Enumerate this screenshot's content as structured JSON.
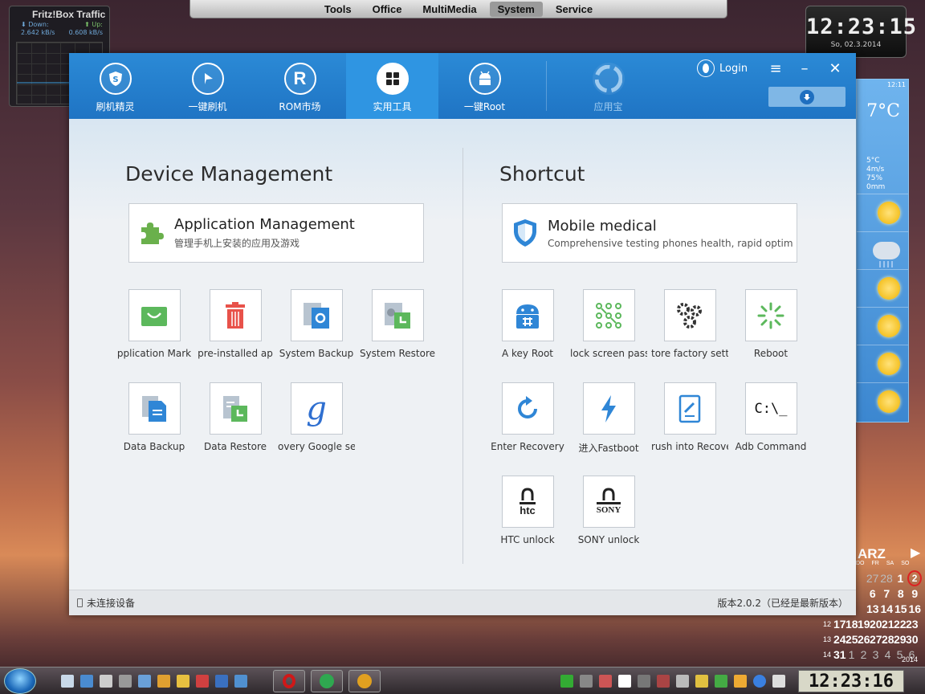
{
  "desktop_menu": {
    "items": [
      "Tools",
      "Office",
      "MultiMedia",
      "System",
      "Service"
    ],
    "active_index": 3
  },
  "fritzbox": {
    "title": "Fritz!Box Traffic",
    "down_label": "Down:",
    "down_value": "2.642 kB/s",
    "up_label": "Up:",
    "up_value": "0.608 kB/s"
  },
  "clock_gadget": {
    "time": "12:23:15",
    "date": "So, 02.3.2014"
  },
  "weather": {
    "small_time": "12:11",
    "temp": "7°C",
    "details": [
      "5°C",
      "4m/s",
      "75%",
      "0mm"
    ],
    "forecast_icons": [
      "sun-icon",
      "rain-cloud-icon",
      "sun-icon",
      "sun-icon",
      "sun-icon",
      "sun-icon"
    ]
  },
  "calendar": {
    "month": "ARZ",
    "weekday_headers": [
      "DO",
      "FR",
      "SA",
      "SO"
    ],
    "weeks": [
      {
        "kw": "",
        "days": [
          "27",
          "28",
          "1",
          "2"
        ]
      },
      {
        "kw": "",
        "days": [
          "6",
          "7",
          "8",
          "9"
        ]
      },
      {
        "kw": "",
        "days": [
          "13",
          "14",
          "15",
          "16"
        ]
      },
      {
        "kw": "12",
        "days": [
          "17",
          "18",
          "19",
          "20",
          "21",
          "22",
          "23"
        ]
      },
      {
        "kw": "13",
        "days": [
          "24",
          "25",
          "26",
          "27",
          "28",
          "29",
          "30"
        ]
      },
      {
        "kw": "14",
        "days": [
          "31",
          "1",
          "2",
          "3",
          "4",
          "5",
          "6"
        ]
      }
    ],
    "year": "2014"
  },
  "app": {
    "nav": [
      {
        "label": "刷机精灵",
        "icon": "shield-s-icon"
      },
      {
        "label": "一键刷机",
        "icon": "play-icon"
      },
      {
        "label": "ROM市场",
        "icon": "r-icon"
      },
      {
        "label": "实用工具",
        "icon": "grid-icon"
      },
      {
        "label": "一键Root",
        "icon": "android-icon"
      },
      {
        "label": "应用宝",
        "icon": "yingyongbao-icon"
      }
    ],
    "active_nav_index": 3,
    "login_label": "Login",
    "device_section": {
      "title": "Device Management",
      "card": {
        "title": "Application Management",
        "subtitle": "管理手机上安装的应用及游戏",
        "icon": "puzzle-icon"
      },
      "tiles": [
        {
          "label": "pplication Mark",
          "icon": "shopping-bag-icon"
        },
        {
          "label": "pre-installed ap",
          "icon": "trash-icon"
        },
        {
          "label": "System Backup",
          "icon": "system-backup-icon"
        },
        {
          "label": "System Restore",
          "icon": "system-restore-icon"
        },
        {
          "label": "Data Backup",
          "icon": "data-backup-icon"
        },
        {
          "label": "Data Restore",
          "icon": "data-restore-icon"
        },
        {
          "label": "overy Google ser",
          "icon": "google-icon"
        }
      ]
    },
    "shortcut_section": {
      "title": "Shortcut",
      "card": {
        "title": "Mobile medical",
        "subtitle": "Comprehensive testing phones health, rapid optimiza",
        "icon": "shield-icon"
      },
      "tiles": [
        {
          "label": "A key Root",
          "icon": "android-root-icon"
        },
        {
          "label": "lock screen pass",
          "icon": "pattern-lock-icon"
        },
        {
          "label": "tore factory setti",
          "icon": "gears-icon"
        },
        {
          "label": "Reboot",
          "icon": "reboot-icon"
        },
        {
          "label": "Enter Recovery",
          "icon": "refresh-icon"
        },
        {
          "label": "进入Fastboot",
          "icon": "lightning-icon"
        },
        {
          "label": "rush into Recove",
          "icon": "tablet-edit-icon"
        },
        {
          "label": "Adb Command",
          "icon": "terminal-icon"
        },
        {
          "label": "HTC unlock",
          "icon": "htc-lock-icon"
        },
        {
          "label": "SONY unlock",
          "icon": "sony-lock-icon"
        }
      ],
      "terminal_text": "C:\\_",
      "htc_text": "htc",
      "sony_text": "SONY"
    },
    "status_left": "未连接设备",
    "status_right": "版本2.0.2（已经是最新版本）"
  },
  "taskbar": {
    "clock": "12:23:16"
  },
  "colors": {
    "accent_blue": "#2b8ad6",
    "green": "#6ab04c",
    "red": "#e8524a"
  }
}
